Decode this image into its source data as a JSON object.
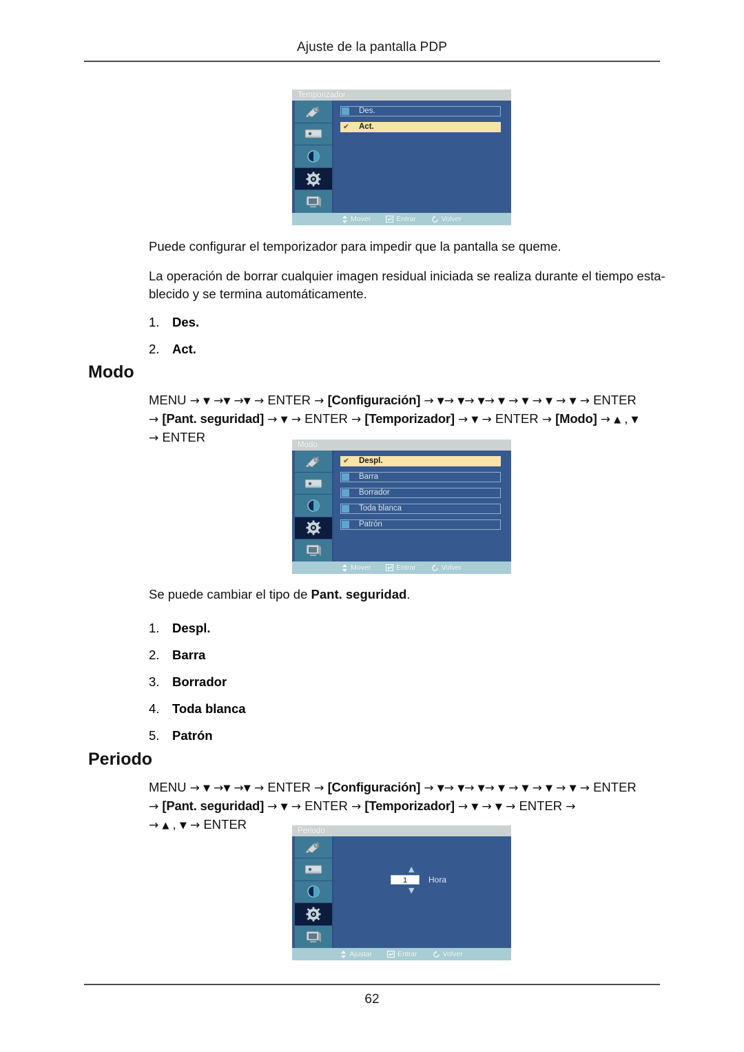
{
  "document": {
    "running_header": "Ajuste de la pantalla PDP",
    "page_number": "62"
  },
  "osd_timer": {
    "title": "Temporizador",
    "options": [
      {
        "label": "Des.",
        "selected": false
      },
      {
        "label": "Act.",
        "selected": true
      }
    ],
    "footer": [
      {
        "icon": "updown-arrows-icon",
        "label": "Mover"
      },
      {
        "icon": "enter-key-icon",
        "label": "Entrar"
      },
      {
        "icon": "return-icon",
        "label": "Volver"
      }
    ]
  },
  "intro": {
    "paragraph_1": "Puede configurar el temporizador para impedir que la pantalla se queme.",
    "paragraph_2_line_1": "La operación de borrar cualquier imagen residual iniciada se realiza durante el tiempo esta-",
    "paragraph_2_line_2": "blecido y se termina automáticamente.",
    "list": [
      {
        "num": "1.",
        "label": "Des."
      },
      {
        "num": "2.",
        "label": "Act."
      }
    ]
  },
  "modo_section": {
    "heading": "Modo",
    "path_line_1": {
      "start": "MENU",
      "arrow": "→",
      "down": "▼",
      "enter": "ENTER",
      "bracket_1": "[Configuración]",
      "down_count_head": 3,
      "down_count_tail": 7,
      "end": "ENTER"
    },
    "path_line_2": {
      "bracket_1": "[Pant. seguridad]",
      "enter_1": "ENTER",
      "bracket_2": "[Temporizador]",
      "enter_2": "ENTER",
      "bracket_3": "[Modo]",
      "up": "▲",
      "down": "▼"
    },
    "path_line_3": {
      "end": "ENTER"
    },
    "caption_prefix": "Se puede cambiar el tipo de ",
    "caption_bold": "Pant. seguridad",
    "caption_suffix": ".",
    "list": [
      {
        "num": "1.",
        "label": "Despl."
      },
      {
        "num": "2.",
        "label": "Barra"
      },
      {
        "num": "3.",
        "label": "Borrador"
      },
      {
        "num": "4.",
        "label": "Toda blanca"
      },
      {
        "num": "5.",
        "label": "Patrón"
      }
    ]
  },
  "osd_modo": {
    "title": "Modo",
    "options": [
      {
        "label": "Despl.",
        "selected": true
      },
      {
        "label": "Barra",
        "selected": false
      },
      {
        "label": "Borrador",
        "selected": false
      },
      {
        "label": "Toda blanca",
        "selected": false
      },
      {
        "label": "Patrón",
        "selected": false
      }
    ],
    "footer": [
      {
        "icon": "updown-arrows-icon",
        "label": "Mover"
      },
      {
        "icon": "enter-key-icon",
        "label": "Entrar"
      },
      {
        "icon": "return-icon",
        "label": "Volver"
      }
    ]
  },
  "periodo_section": {
    "heading": "Periodo",
    "path_line_1": {
      "start": "MENU",
      "enter": "ENTER",
      "bracket_1": "[Configuración]",
      "end": "ENTER"
    },
    "path_line_2": {
      "bracket_1": "[Pant. seguridad]",
      "enter_1": "ENTER",
      "bracket_2": "[Temporizador]",
      "enter_2": "ENTER"
    },
    "path_line_3": {
      "up": "▲",
      "down": "▼",
      "end": "ENTER"
    }
  },
  "osd_periodo": {
    "title": "Periodo",
    "value": "1",
    "unit": "Hora",
    "up_arrow": "▲",
    "down_arrow": "▼",
    "footer": [
      {
        "icon": "updown-arrows-icon",
        "label": "Ajustar"
      },
      {
        "icon": "enter-key-icon",
        "label": "Entrar"
      },
      {
        "icon": "return-icon",
        "label": "Volver"
      }
    ]
  },
  "osd_sidebar_icons": [
    "picture-brush-icon",
    "image-frame-icon",
    "contrast-circle-icon",
    "gear-setup-icon",
    "monitor-display-icon"
  ],
  "colors": {
    "osd_background": "#36598f",
    "osd_titlebar": "#ccd2d2",
    "osd_sidebar": "#3c7a96",
    "osd_sidebar_selected": "#0d1b3d",
    "osd_footer": "#a8cdd4",
    "option_highlight": "#fae3a8",
    "option_swatch": "#5fa6d0"
  }
}
